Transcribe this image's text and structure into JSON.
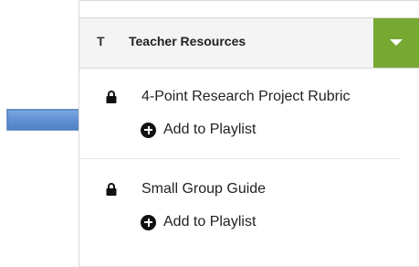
{
  "header": {
    "letter": "T",
    "title": "Teacher Resources",
    "dropdown_icon": "caret-down-icon",
    "accent_color": "#77a831"
  },
  "items": [
    {
      "name": "4-Point Research Project Rubric",
      "action": "Add to Playlist",
      "icon": "lock-icon"
    },
    {
      "name": "Small Group Guide",
      "action": "Add to Playlist",
      "icon": "lock-icon"
    }
  ],
  "arrow_color": "#6f9ed8"
}
